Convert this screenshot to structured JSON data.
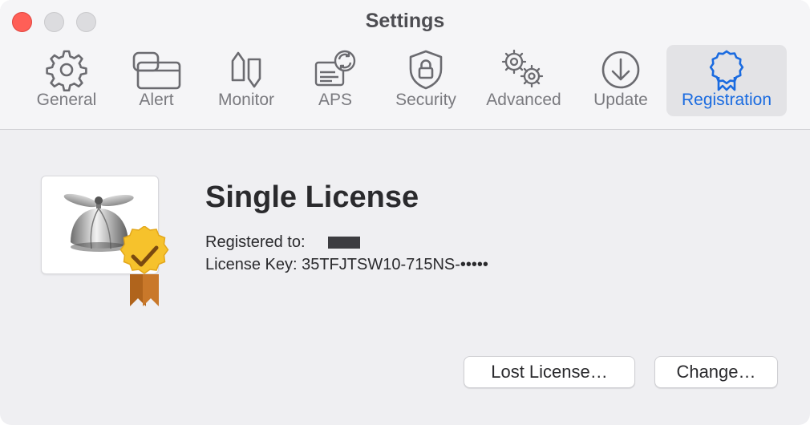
{
  "window": {
    "title": "Settings"
  },
  "tabs": [
    {
      "id": "general",
      "label": "General",
      "icon": "gear-icon"
    },
    {
      "id": "alert",
      "label": "Alert",
      "icon": "alert-window-icon"
    },
    {
      "id": "monitor",
      "label": "Monitor",
      "icon": "monitor-arrows-icon"
    },
    {
      "id": "aps",
      "label": "APS",
      "icon": "aps-sync-icon"
    },
    {
      "id": "security",
      "label": "Security",
      "icon": "shield-lock-icon"
    },
    {
      "id": "advanced",
      "label": "Advanced",
      "icon": "gears-icon"
    },
    {
      "id": "update",
      "label": "Update",
      "icon": "download-circle-icon"
    },
    {
      "id": "registration",
      "label": "Registration",
      "icon": "award-ribbon-icon",
      "selected": true
    }
  ],
  "registration": {
    "license_title": "Single License",
    "registered_to_label": "Registered to:",
    "registered_to_value": "(redacted)",
    "license_key_label": "License Key:",
    "license_key_value": "35TFJTSW10-715NS-•••••",
    "app_icon": "propeller-cap-icon",
    "badge_icon": "verified-seal-icon"
  },
  "buttons": {
    "lost_license": "Lost License…",
    "change": "Change…"
  },
  "colors": {
    "accent": "#1a6be0",
    "close": "#ff5f57",
    "badge_gold": "#f6c22c",
    "ribbon_brown": "#b0641c"
  }
}
